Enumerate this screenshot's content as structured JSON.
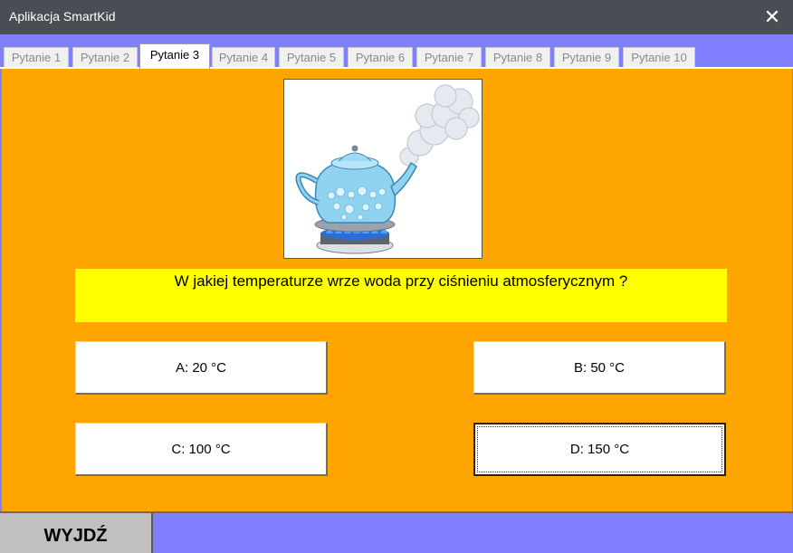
{
  "window": {
    "title": "Aplikacja SmartKid",
    "close_icon": "close-icon"
  },
  "tabs": [
    {
      "label": "Pytanie 1",
      "active": false
    },
    {
      "label": "Pytanie 2",
      "active": false
    },
    {
      "label": "Pytanie 3",
      "active": true
    },
    {
      "label": "Pytanie 4",
      "active": false
    },
    {
      "label": "Pytanie 5",
      "active": false
    },
    {
      "label": "Pytanie 6",
      "active": false
    },
    {
      "label": "Pytanie 7",
      "active": false
    },
    {
      "label": "Pytanie 8",
      "active": false
    },
    {
      "label": "Pytanie 9",
      "active": false
    },
    {
      "label": "Pytanie 10",
      "active": false
    }
  ],
  "question": {
    "text": "W jakiej temperaturze wrze woda przy ciśnieniu atmosferycznym ?",
    "image": "boiling-kettle-on-gas-burner"
  },
  "answers": [
    {
      "label": "A: 20 °C"
    },
    {
      "label": "B: 50 °C"
    },
    {
      "label": "C: 100 °C"
    },
    {
      "label": "D: 150 °C",
      "focused": true
    }
  ],
  "footer": {
    "exit_label": "WYJDŹ"
  },
  "colors": {
    "tab_strip_bg": "#8080ff",
    "panel_bg": "#ffa500",
    "question_bg": "#ffff00",
    "titlebar_bg": "#4a4e54"
  }
}
